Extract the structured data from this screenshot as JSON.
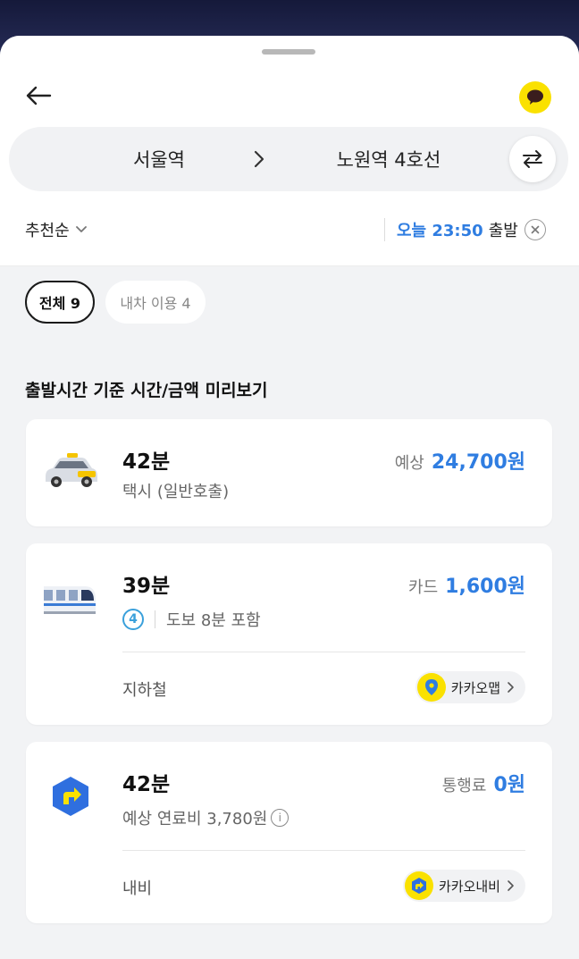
{
  "header": {
    "origin": "서울역",
    "destination": "노원역 4호선"
  },
  "filters": {
    "sort_label": "추천순",
    "time_highlight": "오늘 23:50",
    "time_suffix": "출발"
  },
  "chips": {
    "all": "전체 9",
    "car": "내차 이용 4"
  },
  "section_title": "출발시간 기준 시간/금액 미리보기",
  "cards": [
    {
      "mode": "taxi",
      "duration": "42분",
      "subtitle": "택시 (일반호출)",
      "price_label": "예상",
      "price_value": "24,700원"
    },
    {
      "mode": "subway",
      "duration": "39분",
      "line": "4",
      "line_color": "#3aa0db",
      "subtitle": "도보 8분 포함",
      "price_label": "카드",
      "price_value": "1,600원",
      "footer_label": "지하철",
      "app_label": "카카오맵"
    },
    {
      "mode": "navi",
      "duration": "42분",
      "subtitle": "예상 연료비 3,780원",
      "price_label": "통행료",
      "price_value": "0원",
      "footer_label": "내비",
      "app_label": "카카오내비"
    }
  ],
  "colors": {
    "accent": "#2f7de1",
    "kakao_yellow": "#fae100",
    "line4": "#3aa0db"
  }
}
